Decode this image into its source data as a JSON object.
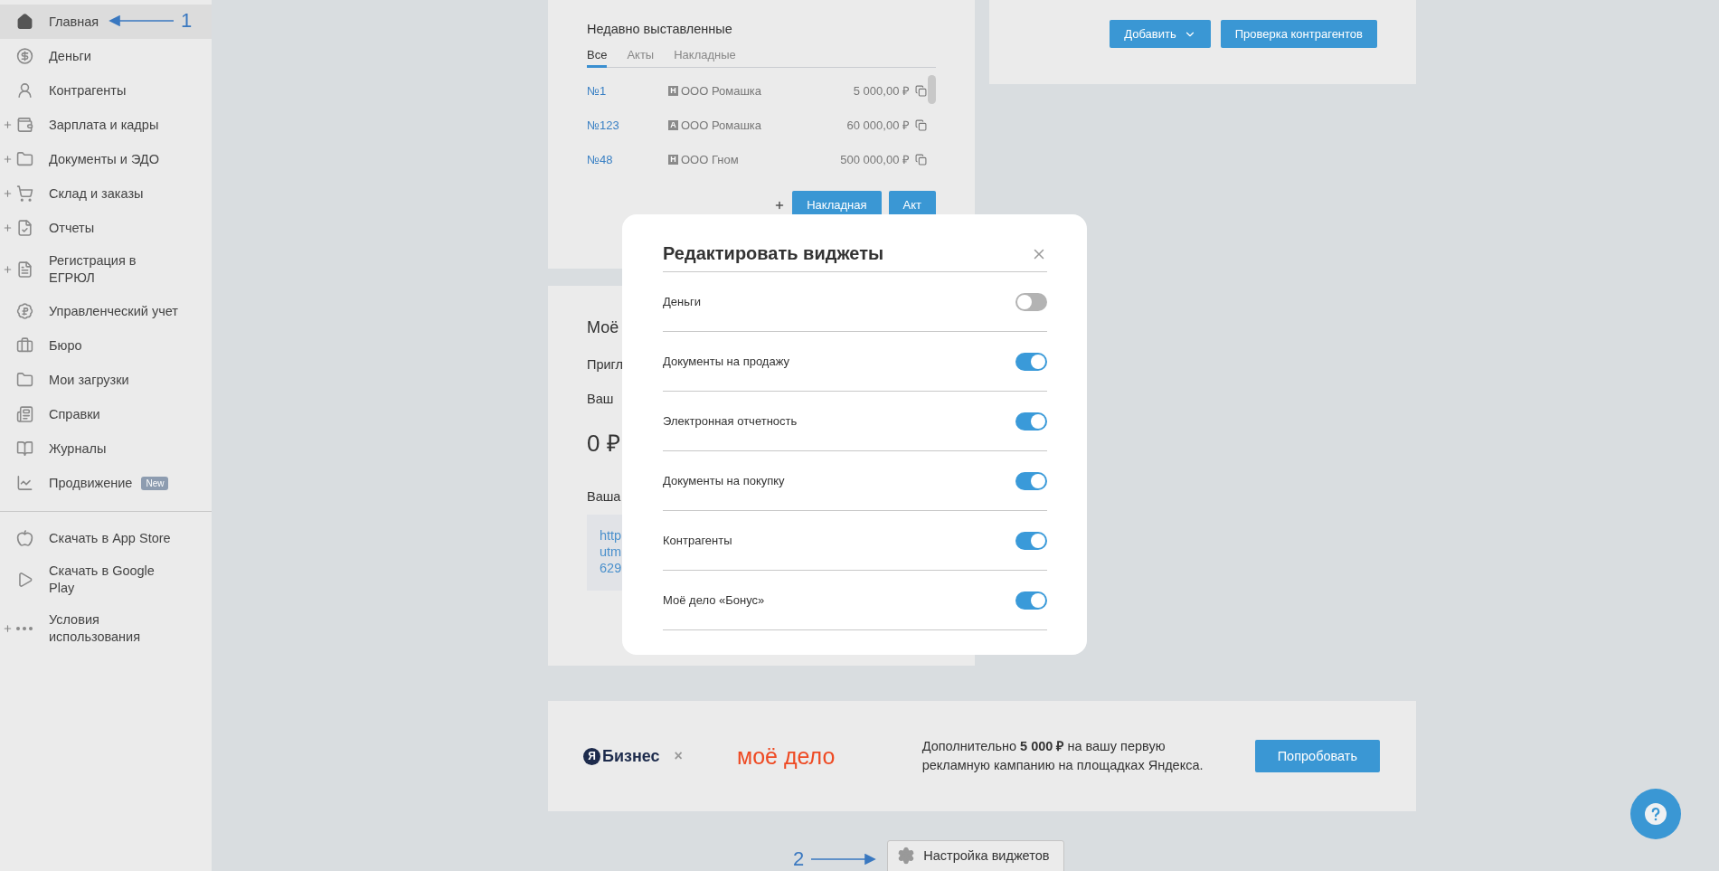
{
  "sidebar": {
    "items": [
      {
        "label": "Главная",
        "selected": true,
        "expandable": false
      },
      {
        "label": "Деньги",
        "selected": false,
        "expandable": false
      },
      {
        "label": "Контрагенты",
        "selected": false,
        "expandable": false
      },
      {
        "label": "Зарплата и кадры",
        "selected": false,
        "expandable": true
      },
      {
        "label": "Документы и ЭДО",
        "selected": false,
        "expandable": true
      },
      {
        "label": "Склад и заказы",
        "selected": false,
        "expandable": true
      },
      {
        "label": "Отчеты",
        "selected": false,
        "expandable": true
      },
      {
        "label": "Регистрация в ЕГРЮЛ",
        "selected": false,
        "expandable": true
      },
      {
        "label": "Управленческий учет",
        "selected": false,
        "expandable": false
      },
      {
        "label": "Бюро",
        "selected": false,
        "expandable": false
      },
      {
        "label": "Мои загрузки",
        "selected": false,
        "expandable": false
      },
      {
        "label": "Справки",
        "selected": false,
        "expandable": false
      },
      {
        "label": "Журналы",
        "selected": false,
        "expandable": false
      },
      {
        "label": "Продвижение",
        "selected": false,
        "expandable": false,
        "badge": "New"
      }
    ],
    "footer_items": [
      {
        "label": "Скачать в App Store",
        "selected": false,
        "expandable": false
      },
      {
        "label": "Скачать в Google Play",
        "selected": false,
        "expandable": false
      },
      {
        "label": "Условия использования",
        "selected": false,
        "expandable": true
      }
    ]
  },
  "annotations": [
    {
      "label": "1"
    },
    {
      "label": "2"
    }
  ],
  "recent_card": {
    "title": "Недавно выставленные",
    "tabs": [
      {
        "label": "Все",
        "selected": true
      },
      {
        "label": "Акты",
        "selected": false
      },
      {
        "label": "Накладные",
        "selected": false
      }
    ],
    "rows": [
      {
        "number": "№1",
        "badge": "Н",
        "company": "ООО Ромашка",
        "amount": "5 000,00 ₽"
      },
      {
        "number": "№123",
        "badge": "А",
        "company": "ООО Ромашка",
        "amount": "60 000,00 ₽"
      },
      {
        "number": "№48",
        "badge": "Н",
        "company": "ООО Гном",
        "amount": "500 000,00 ₽"
      }
    ],
    "buttons": [
      "Накладная",
      "Акт"
    ]
  },
  "actions_card": {
    "buttons": [
      {
        "label": "Добавить",
        "kind": "dropdown"
      },
      {
        "label": "Проверка контрагентов",
        "kind": "plain"
      }
    ]
  },
  "bonus_card": {
    "title": "Моё",
    "lines": [
      "Пригл",
      "Ваш"
    ],
    "balance": "0 ₽",
    "link_label": "Ваша",
    "link_lines": [
      "http",
      "utm",
      "629"
    ]
  },
  "banner": {
    "partner_mark": "Я",
    "partner_name": "Бизнес",
    "separator": "×",
    "brand": "моё дело",
    "text": "Дополнительно **5 000 ₽** на вашу первую рекламную кампанию на площадках Яндекса.",
    "button": "Попробовать"
  },
  "settings_button": "Настройка виджетов",
  "modal": {
    "title": "Редактировать виджеты",
    "widgets": [
      {
        "label": "Деньги",
        "on": false
      },
      {
        "label": "Документы на продажу",
        "on": true
      },
      {
        "label": "Электронная отчетность",
        "on": true
      },
      {
        "label": "Документы на покупку",
        "on": true
      },
      {
        "label": "Контрагенты",
        "on": true
      },
      {
        "label": "Моё дело «Бонус»",
        "on": true
      }
    ]
  }
}
